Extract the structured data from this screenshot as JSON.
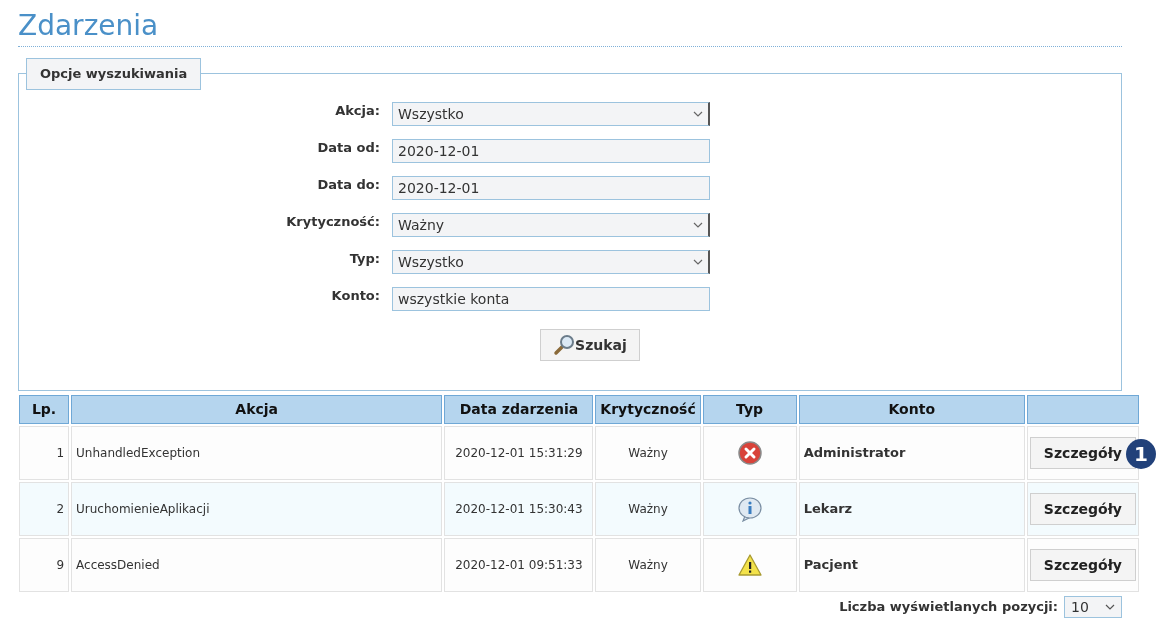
{
  "title": "Zdarzenia",
  "search_options": {
    "legend": "Opcje wyszukiwania",
    "fields": [
      {
        "label": "Akcja:",
        "kind": "select",
        "value": "Wszystko"
      },
      {
        "label": "Data od:",
        "kind": "text",
        "value": "2020-12-01"
      },
      {
        "label": "Data do:",
        "kind": "text",
        "value": "2020-12-01"
      },
      {
        "label": "Krytyczność:",
        "kind": "select",
        "value": "Ważny"
      },
      {
        "label": "Typ:",
        "kind": "select",
        "value": "Wszystko"
      },
      {
        "label": "Konto:",
        "kind": "text",
        "value": "wszystkie konta"
      }
    ],
    "search_button": "Szukaj"
  },
  "table": {
    "columns": [
      "Lp.",
      "Akcja",
      "Data zdarzenia",
      "Krytyczność",
      "Typ",
      "Konto"
    ],
    "rows": [
      {
        "lp": "1",
        "action": "UnhandledException",
        "date": "2020-12-01 15:31:29",
        "severity": "Ważny",
        "kind": "error",
        "account": "Administrator",
        "button": "Szczegóły",
        "callout": "1"
      },
      {
        "lp": "2",
        "action": "UruchomienieAplikacji",
        "date": "2020-12-01 15:30:43",
        "severity": "Ważny",
        "kind": "info",
        "account": "Lekarz",
        "button": "Szczegóły"
      },
      {
        "lp": "9",
        "action": "AccessDenied",
        "date": "2020-12-01 09:51:33",
        "severity": "Ważny",
        "kind": "warning",
        "account": "Pacjent",
        "button": "Szczegóły"
      }
    ]
  },
  "page_size": {
    "label": "Liczba wyświetlanych pozycji:",
    "value": "10"
  }
}
